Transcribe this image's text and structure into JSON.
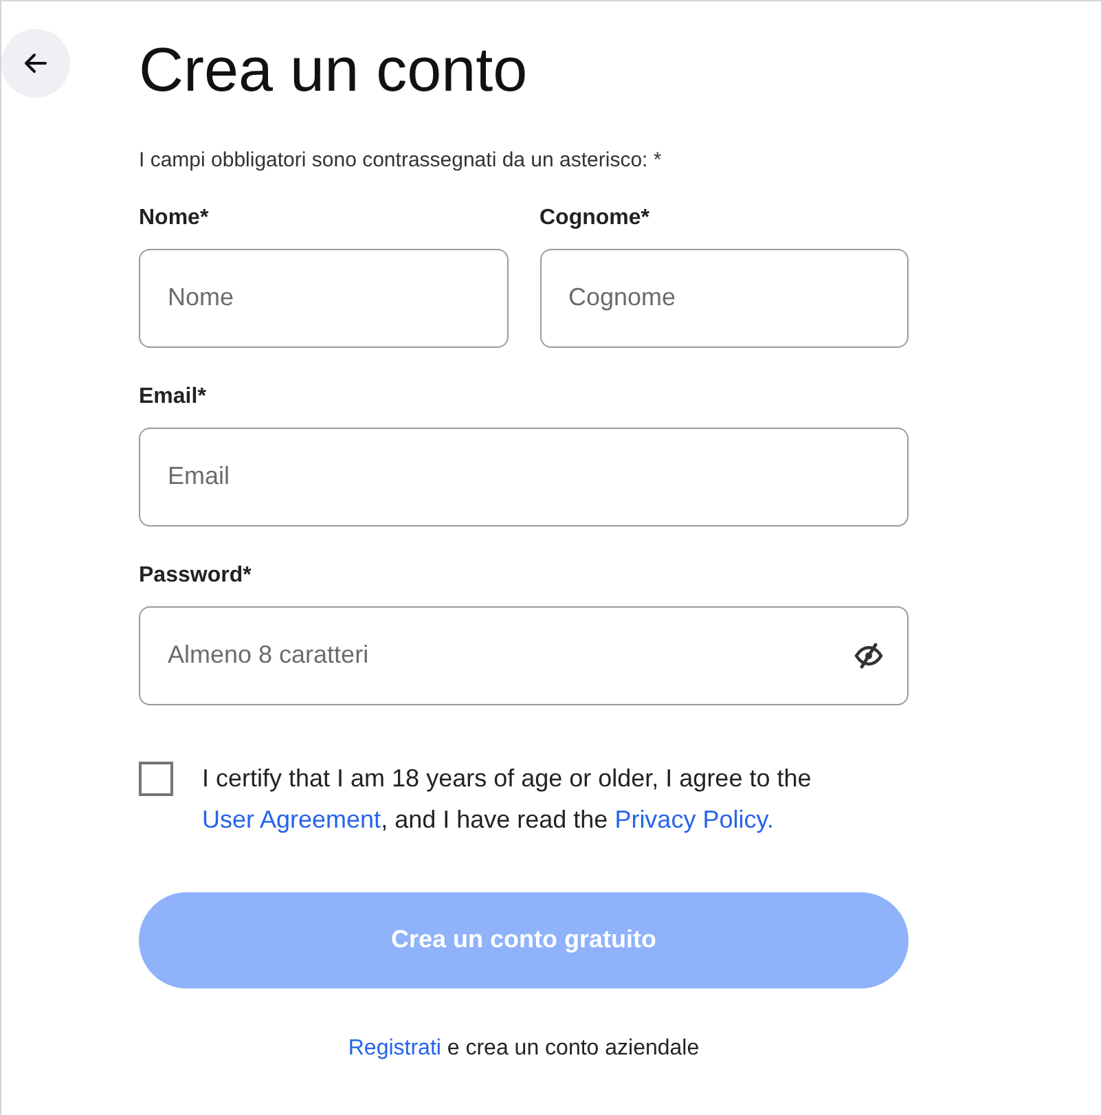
{
  "title": "Crea un conto",
  "required_note": "I campi obbligatori sono contrassegnati da un asterisco: *",
  "fields": [
    {
      "label": "Nome*",
      "placeholder": "Nome",
      "half": true,
      "kind": "text"
    },
    {
      "label": "Cognome*",
      "placeholder": "Cognome",
      "half": true,
      "kind": "text"
    },
    {
      "label": "Email*",
      "placeholder": "Email",
      "half": false,
      "kind": "text"
    },
    {
      "label": "Password*",
      "placeholder": "Almeno 8 caratteri",
      "half": false,
      "kind": "password"
    }
  ],
  "consent": {
    "checked": false,
    "parts": [
      {
        "kind": "text",
        "text": "I certify that I am 18 years of age or older, I agree to the "
      },
      {
        "kind": "link",
        "text": "User Agreement"
      },
      {
        "kind": "text",
        "text": ", and I have read the "
      },
      {
        "kind": "link",
        "text": "Privacy Policy."
      }
    ]
  },
  "submit": {
    "label": "Crea un conto gratuito",
    "disabled": true
  },
  "footer": [
    {
      "kind": "link",
      "text": "Registrati"
    },
    {
      "kind": "text",
      "text": " e crea un conto aziendale"
    }
  ]
}
